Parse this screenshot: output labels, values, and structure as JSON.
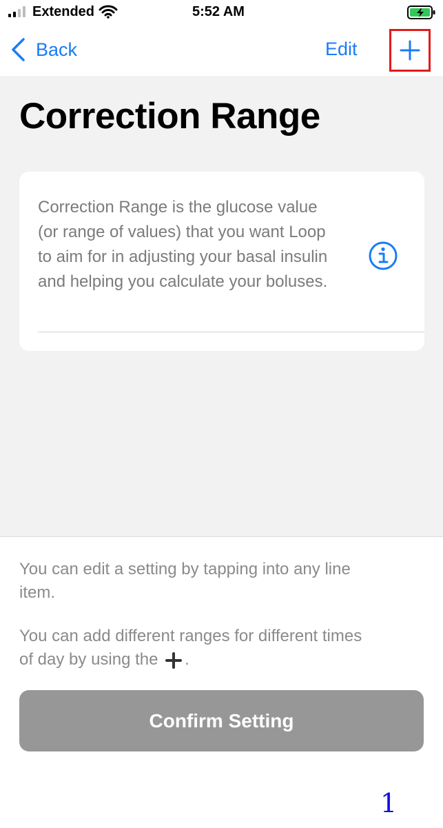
{
  "status_bar": {
    "carrier": "Extended",
    "time": "5:52 AM"
  },
  "nav": {
    "back_label": "Back",
    "edit_label": "Edit"
  },
  "page": {
    "title": "Correction Range"
  },
  "info_card": {
    "description": "Correction Range is the glucose value (or range of values) that you want Loop to aim for in adjusting your basal insulin and helping you calculate your boluses."
  },
  "bottom": {
    "tip_edit": "You can edit a setting by tapping into any line item.",
    "tip_add_prefix": "You can add different ranges for different times of day by using the",
    "tip_add_suffix": ".",
    "confirm_label": "Confirm Setting",
    "page_number": "1"
  },
  "colors": {
    "accent": "#1a7cf5",
    "highlight_box": "#e01b1b",
    "confirm_button": "#979797",
    "battery_charge": "#33c759"
  },
  "icons": {
    "signal": "cellular-signal-icon",
    "wifi": "wifi-icon",
    "battery": "battery-charging-icon",
    "back": "chevron-left-icon",
    "add": "plus-icon",
    "info": "info-circle-icon"
  }
}
